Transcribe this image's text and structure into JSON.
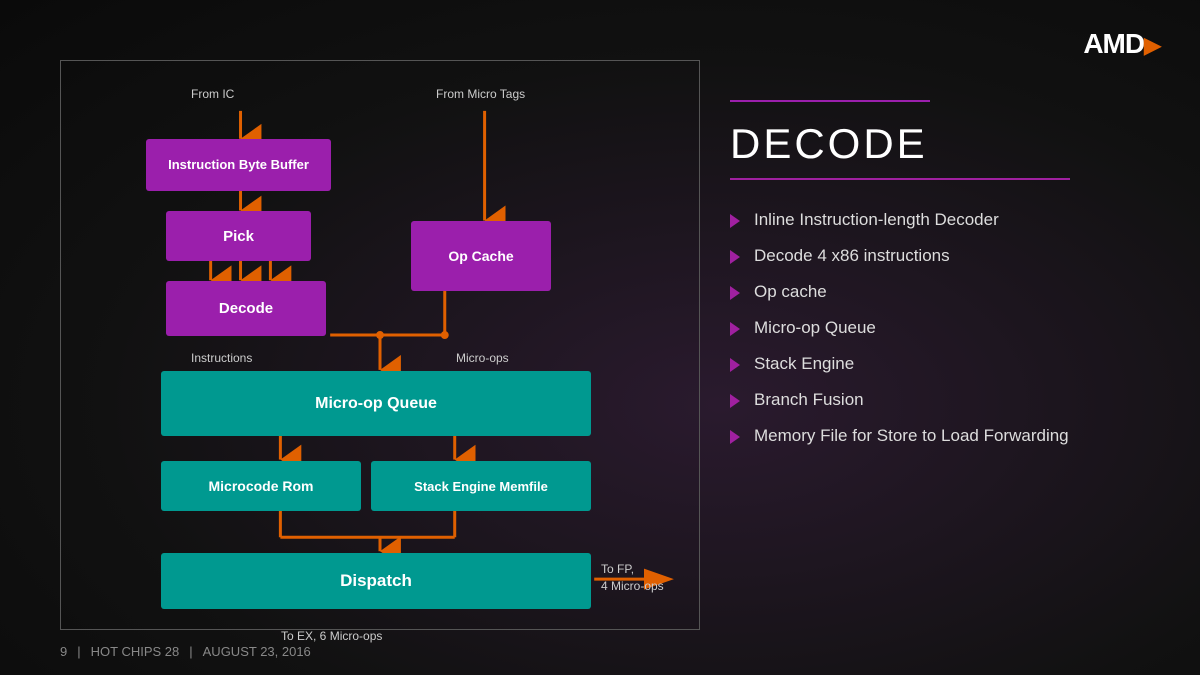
{
  "logo": {
    "text": "AMD",
    "symbol": "▶"
  },
  "diagram": {
    "from_ic_label": "From IC",
    "from_microtags_label": "From Micro Tags",
    "instruction_byte_buffer": "Instruction Byte Buffer",
    "pick": "Pick",
    "decode": "Decode",
    "op_cache": "Op Cache",
    "micro_op_queue": "Micro-op Queue",
    "microcode_rom": "Microcode Rom",
    "stack_engine_memfile": "Stack Engine Memfile",
    "dispatch": "Dispatch",
    "instructions_label": "Instructions",
    "micro_ops_label": "Micro-ops",
    "to_fp_label": "To FP,",
    "to_fp_label2": "4 Micro-ops",
    "to_ex_label": "To EX, 6 Micro-ops"
  },
  "right_panel": {
    "title": "DECODE",
    "features": [
      "Inline Instruction-length Decoder",
      "Decode 4 x86 instructions",
      "Op cache",
      "Micro-op Queue",
      "Stack Engine",
      "Branch Fusion",
      "Memory File for Store to Load Forwarding"
    ]
  },
  "footer": {
    "page_num": "9",
    "event": "HOT CHIPS 28",
    "date": "AUGUST 23, 2016"
  }
}
